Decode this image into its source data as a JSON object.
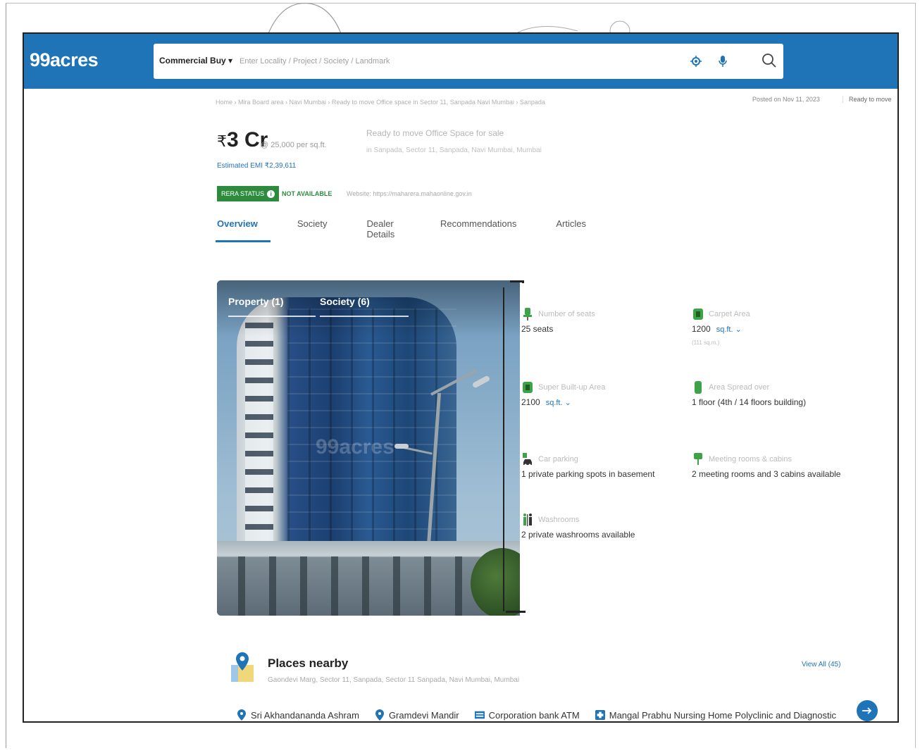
{
  "header": {
    "logo": "99acres",
    "search_type": "Commercial Buy ▾",
    "search_placeholder": "Enter Locality / Project / Society / Landmark"
  },
  "listing": {
    "breadcrumb": "Home › Mira Board area › Navi Mumbai › Ready to move Office space in Sector 11, Sanpada Navi Mumbai › Sanpada",
    "posted": "Posted on Nov 11, 2023",
    "ready_tag": "Ready to move",
    "price": "3 Cr",
    "price_per_sqft": "@ 25,000 per sq.ft.",
    "title": "Ready to move Office Space for sale",
    "address": "in Sanpada, Sector 11, Sanpada, Navi Mumbai, Mumbai",
    "emi": "Estimated EMI ₹2,39,611",
    "rera_badge": "RERA STATUS",
    "rera_status": "NOT AVAILABLE",
    "rera_website": "Website: https://maharera.mahaonline.gov.in"
  },
  "tabs": [
    "Overview",
    "Society",
    "Dealer Details",
    "Recommendations",
    "Articles"
  ],
  "gallery": {
    "tab_property": "Property (1)",
    "tab_society": "Society (6)",
    "watermark": "99acres"
  },
  "details": [
    {
      "label": "Number of seats",
      "value": "25 seats",
      "unit": "",
      "sub": ""
    },
    {
      "label": "Carpet Area",
      "value": "1200",
      "unit": "sq.ft. ⌄",
      "sub": "(111 sq.m.)"
    },
    {
      "label": "Super Built-up Area",
      "value": "2100",
      "unit": "sq.ft. ⌄",
      "sub": ""
    },
    {
      "label": "Area Spread over",
      "value": "1 floor (4th / 14 floors building)",
      "unit": "",
      "sub": ""
    },
    {
      "label": "Car parking",
      "value": "1 private parking spots in basement",
      "unit": "",
      "sub": ""
    },
    {
      "label": "Meeting rooms & cabins",
      "value": "2 meeting rooms and 3 cabins available",
      "unit": "",
      "sub": ""
    },
    {
      "label": "Washrooms",
      "value": "2 private washrooms available",
      "unit": "",
      "sub": ""
    }
  ],
  "places": {
    "title": "Places nearby",
    "address": "Gaondevi Marg, Sector 11, Sanpada, Sector 11 Sanpada, Navi Mumbai, Mumbai",
    "view_all": "View All (45)",
    "items": [
      {
        "label": "Sri Akhandananda Ashram",
        "icon": "map-pin-icon"
      },
      {
        "label": "Gramdevi Mandir",
        "icon": "map-pin-icon"
      },
      {
        "label": "Corporation bank ATM",
        "icon": "atm-icon"
      },
      {
        "label": "Mangal Prabhu Nursing Home Polyclinic and Diagnostic",
        "icon": "hospital-icon"
      }
    ]
  },
  "colors": {
    "brand": "#1f74b8",
    "rera_green": "#2e8b3d",
    "icon_green": "#3da346"
  }
}
